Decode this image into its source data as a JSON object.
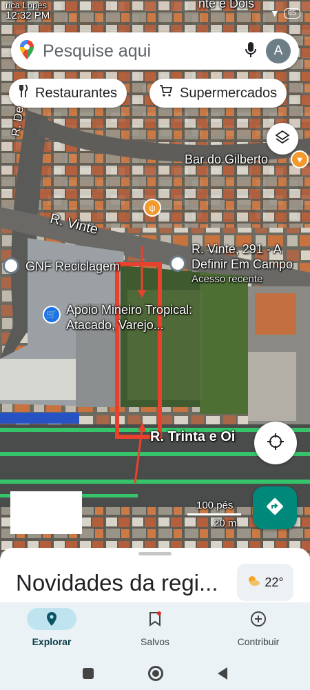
{
  "status_bar": {
    "carrier": "rica Lopes",
    "time": "12:32 PM",
    "top_partial_label": "nte e Dois",
    "battery": "85"
  },
  "search": {
    "placeholder": "Pesquise aqui",
    "avatar_initial": "A"
  },
  "chips": [
    {
      "label": "Restaurantes",
      "icon": "fork-knife-icon"
    },
    {
      "label": "Supermercados",
      "icon": "cart-icon"
    }
  ],
  "map": {
    "streets": {
      "r_de_vertical": "R. De",
      "r_vinte": "R. Vinte",
      "r_trinta": "R. Trinta e Oi"
    },
    "places": {
      "bar": "Bar do Gilberto",
      "gnf": "GNF Reciclagem",
      "apoio_line1": "Apoio Mineiro Tropical:",
      "apoio_line2": "Atacado, Varejo...",
      "address_line1": "R. Vinte, 291 - A",
      "address_line2": "Definir Em Campo",
      "recent": "Acesso recente"
    },
    "scale": {
      "feet": "100 pés",
      "meters": "20 m"
    },
    "colors": {
      "highlight": "#e8412d",
      "road_green": "#35c46a"
    }
  },
  "sheet": {
    "title": "Novidades da regi...",
    "temperature": "22°"
  },
  "bottom_nav": [
    {
      "label": "Explorar",
      "icon": "explore-pin-icon",
      "active": true
    },
    {
      "label": "Salvos",
      "icon": "bookmark-icon",
      "active": false
    },
    {
      "label": "Contribuir",
      "icon": "add-circle-icon",
      "active": false
    }
  ],
  "accent_color": "#00897b"
}
